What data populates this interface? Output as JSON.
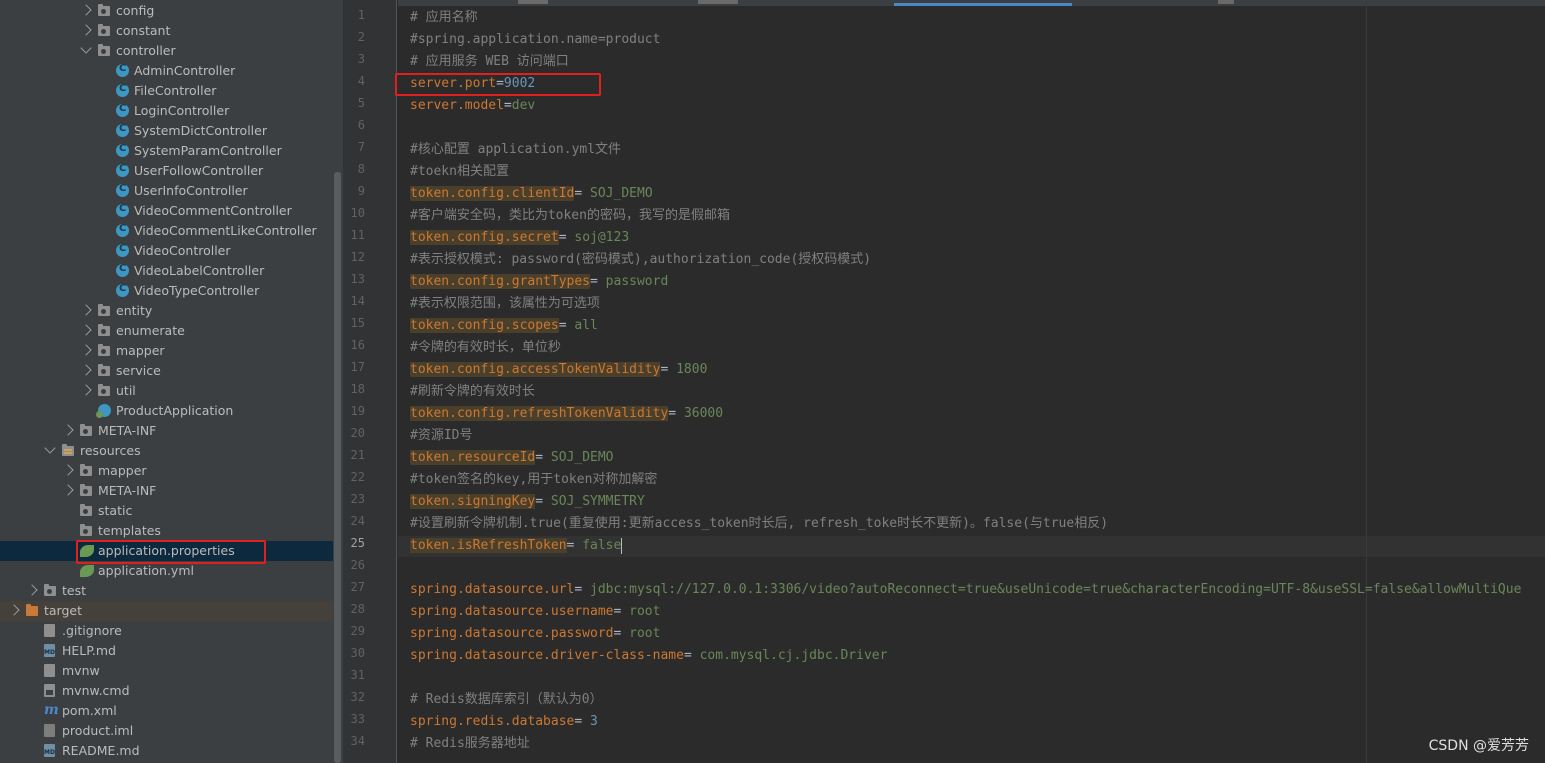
{
  "project_tree": [
    {
      "label": "config",
      "icon": "folder-icon",
      "expanded": false
    },
    {
      "label": "constant",
      "icon": "folder-icon",
      "expanded": false
    },
    {
      "label": "controller",
      "icon": "folder-icon",
      "expanded": true
    },
    {
      "label": "AdminController",
      "icon": "class-icon"
    },
    {
      "label": "FileController",
      "icon": "class-icon"
    },
    {
      "label": "LoginController",
      "icon": "class-icon"
    },
    {
      "label": "SystemDictController",
      "icon": "class-icon"
    },
    {
      "label": "SystemParamController",
      "icon": "class-icon"
    },
    {
      "label": "UserFollowController",
      "icon": "class-icon"
    },
    {
      "label": "UserInfoController",
      "icon": "class-icon"
    },
    {
      "label": "VideoCommentController",
      "icon": "class-icon"
    },
    {
      "label": "VideoCommentLikeController",
      "icon": "class-icon"
    },
    {
      "label": "VideoController",
      "icon": "class-icon"
    },
    {
      "label": "VideoLabelController",
      "icon": "class-icon"
    },
    {
      "label": "VideoTypeController",
      "icon": "class-icon"
    },
    {
      "label": "entity",
      "icon": "folder-icon",
      "expanded": false
    },
    {
      "label": "enumerate",
      "icon": "folder-icon",
      "expanded": false
    },
    {
      "label": "mapper",
      "icon": "folder-icon",
      "expanded": false
    },
    {
      "label": "service",
      "icon": "folder-icon",
      "expanded": false
    },
    {
      "label": "util",
      "icon": "folder-icon",
      "expanded": false
    },
    {
      "label": "ProductApplication",
      "icon": "spring-boot-class-icon"
    },
    {
      "label": "META-INF",
      "icon": "folder-icon",
      "expanded": false
    },
    {
      "label": "resources",
      "icon": "resources-folder-icon",
      "expanded": true
    },
    {
      "label": "mapper",
      "icon": "folder-icon",
      "expanded": false
    },
    {
      "label": "META-INF",
      "icon": "folder-icon",
      "expanded": false
    },
    {
      "label": "static",
      "icon": "folder-icon"
    },
    {
      "label": "templates",
      "icon": "folder-icon"
    },
    {
      "label": "application.properties",
      "icon": "spring-properties-icon",
      "selected": true
    },
    {
      "label": "application.yml",
      "icon": "spring-yml-icon"
    },
    {
      "label": "test",
      "icon": "folder-icon",
      "expanded": false
    },
    {
      "label": "target",
      "icon": "excluded-folder-icon",
      "expanded": false
    },
    {
      "label": ".gitignore",
      "icon": "gitignore-file-icon"
    },
    {
      "label": "HELP.md",
      "icon": "markdown-file-icon"
    },
    {
      "label": "mvnw",
      "icon": "script-file-icon"
    },
    {
      "label": "mvnw.cmd",
      "icon": "cmd-file-icon"
    },
    {
      "label": "pom.xml",
      "icon": "maven-icon"
    },
    {
      "label": "product.iml",
      "icon": "iml-file-icon"
    },
    {
      "label": "README.md",
      "icon": "markdown-file-icon"
    }
  ],
  "editor": {
    "current_line": "25",
    "line_numbers": [
      "1",
      "2",
      "3",
      "4",
      "5",
      "6",
      "7",
      "8",
      "9",
      "10",
      "11",
      "12",
      "13",
      "14",
      "15",
      "16",
      "17",
      "18",
      "19",
      "20",
      "21",
      "22",
      "23",
      "24",
      "25",
      "26",
      "27",
      "28",
      "29",
      "30",
      "31",
      "32",
      "33",
      "34"
    ],
    "lines": [
      {
        "comment": "# 应用名称"
      },
      {
        "comment": "#spring.application.name=product"
      },
      {
        "comment": "# 应用服务 WEB 访问端口"
      },
      {
        "key": "server.port",
        "sep": "=",
        "value": "9002",
        "value_type": "number"
      },
      {
        "key": "server.model",
        "sep": "=",
        "value": "dev"
      },
      {},
      {
        "comment": "#核心配置 application.yml文件"
      },
      {
        "comment": "#toekn相关配置"
      },
      {
        "key": "token.config.clientId",
        "sep": "= ",
        "value": "SOJ_DEMO",
        "hl": true
      },
      {
        "comment": "#客户端安全码，类比为token的密码，我写的是假邮箱"
      },
      {
        "key": "token.config.secret",
        "sep": "= ",
        "value": "soj@123",
        "hl": true
      },
      {
        "comment": "#表示授权模式: password(密码模式),authorization_code(授权码模式)"
      },
      {
        "key": "token.config.grantTypes",
        "sep": "= ",
        "value": "password",
        "hl": true
      },
      {
        "comment": "#表示权限范围，该属性为可选项"
      },
      {
        "key": "token.config.scopes",
        "sep": "= ",
        "value": "all",
        "hl": true
      },
      {
        "comment": "#令牌的有效时长，单位秒"
      },
      {
        "key": "token.config.accessTokenValidity",
        "sep": "= ",
        "value": "1800",
        "hl": true
      },
      {
        "comment": "#刷新令牌的有效时长"
      },
      {
        "key": "token.config.refreshTokenValidity",
        "sep": "= ",
        "value": "36000",
        "hl": true
      },
      {
        "comment": "#资源ID号"
      },
      {
        "key": "token.resourceId",
        "sep": "= ",
        "value": "SOJ_DEMO",
        "hl": true
      },
      {
        "comment": "#token签名的key,用于token对称加解密"
      },
      {
        "key": "token.signingKey",
        "sep": "= ",
        "value": "SOJ_SYMMETRY",
        "hl": true
      },
      {
        "comment": "#设置刷新令牌机制.true(重复使用:更新access_token时长后, refresh_toke时长不更新)。false(与true相反)"
      },
      {
        "key": "token.isRefreshToken",
        "sep": "= ",
        "value": "false",
        "hl": true,
        "caret": true
      },
      {},
      {
        "key": "spring.datasource.url",
        "sep": "= ",
        "value": "jdbc:mysql://127.0.0.1:3306/video?autoReconnect=true&useUnicode=true&characterEncoding=UTF-8&useSSL=false&allowMultiQue"
      },
      {
        "key": "spring.datasource.username",
        "sep": "= ",
        "value": "root"
      },
      {
        "key": "spring.datasource.password",
        "sep": "= ",
        "value": "root"
      },
      {
        "key": "spring.datasource.driver-class-name",
        "sep": "= ",
        "value": "com.mysql.cj.jdbc.Driver"
      },
      {},
      {
        "comment": "# Redis数据库索引（默认为0）"
      },
      {
        "key": "spring.redis.database",
        "sep": "= ",
        "value": "3",
        "value_type": "number"
      },
      {
        "comment": "# Redis服务器地址"
      }
    ]
  },
  "watermark": "CSDN @爱芳芳",
  "colors": {
    "highlight_box": "#e0201d",
    "key": "#cc7832",
    "value": "#6a8759",
    "number": "#6897bb",
    "comment": "#808080"
  }
}
